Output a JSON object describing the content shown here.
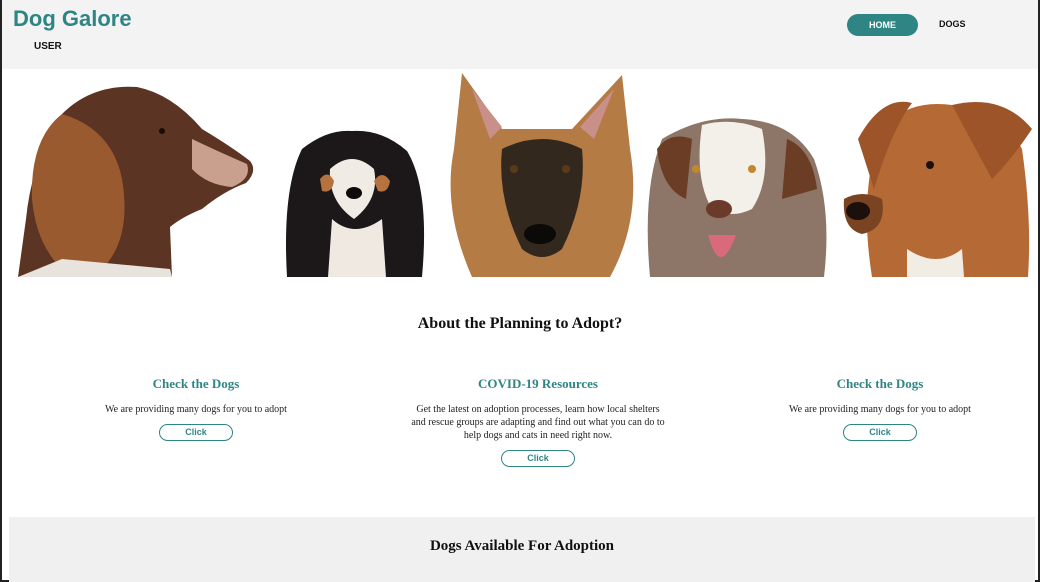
{
  "header": {
    "brand": "Dog Galore",
    "user_link": "USER",
    "nav": {
      "home": "HOME",
      "dogs": "DOGS"
    }
  },
  "hero": {
    "alt": "Five dogs: spaniel, cavalier, german shepherd, australian shepherd, mixed breed"
  },
  "about": {
    "title": "About the Planning to Adopt?"
  },
  "columns": [
    {
      "title": "Check the Dogs",
      "text": "We are providing many dogs for you to adopt",
      "button": "Click"
    },
    {
      "title": "COVID-19 Resources",
      "text": "Get the latest on adoption processes, learn how local shelters and rescue groups are adapting and find out what you can do to help dogs and cats in need right now.",
      "button": "Click"
    },
    {
      "title": "Check the Dogs",
      "text": "We are providing many dogs for you to adopt",
      "button": "Click"
    }
  ],
  "available": {
    "title": "Dogs Available For Adoption"
  },
  "colors": {
    "accent": "#2e8584",
    "header_bg": "#f3f3f3"
  }
}
